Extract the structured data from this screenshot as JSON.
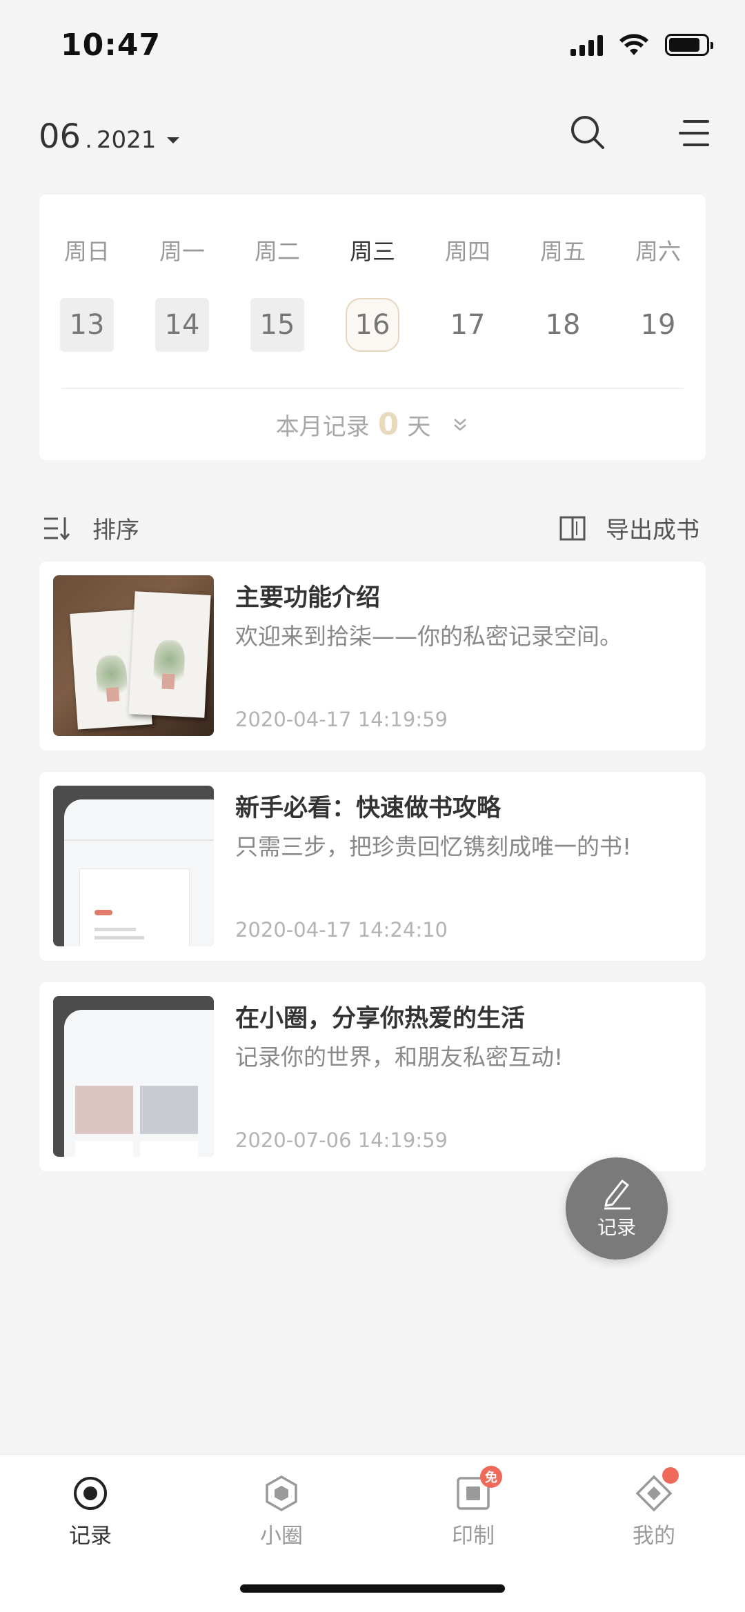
{
  "status_bar": {
    "time": "10:47"
  },
  "header": {
    "month": "06",
    "separator": ".",
    "year": "2021"
  },
  "calendar": {
    "weekdays": [
      "周日",
      "周一",
      "周二",
      "周三",
      "周四",
      "周五",
      "周六"
    ],
    "dates": [
      "13",
      "14",
      "15",
      "16",
      "17",
      "18",
      "19"
    ],
    "summary_prefix": "本月记录",
    "summary_count": "0",
    "summary_suffix": "天"
  },
  "toolbar": {
    "sort_label": "排序",
    "export_label": "导出成书"
  },
  "records": [
    {
      "title": "主要功能介绍",
      "desc": "欢迎来到拾柒——你的私密记录空间。",
      "time": "2020-04-17 14:19:59"
    },
    {
      "title": "新手必看：快速做书攻略",
      "desc": "只需三步，把珍贵回忆镌刻成唯一的书!",
      "time": "2020-04-17 14:24:10"
    },
    {
      "title": "在小圈，分享你热爱的生活",
      "desc": "记录你的世界，和朋友私密互动!",
      "time": "2020-07-06 14:19:59"
    }
  ],
  "fab": {
    "label": "记录"
  },
  "tabs": [
    {
      "label": "记录",
      "icon": "record-icon"
    },
    {
      "label": "小圈",
      "icon": "circle-hexagon-icon"
    },
    {
      "label": "印制",
      "icon": "print-icon",
      "badge": "免"
    },
    {
      "label": "我的",
      "icon": "profile-diamond-icon"
    }
  ],
  "colors": {
    "accent": "#e9d9bd",
    "badge": "#ef6a5a",
    "fab": "#7a7a7a",
    "background": "#f4f4f4"
  }
}
